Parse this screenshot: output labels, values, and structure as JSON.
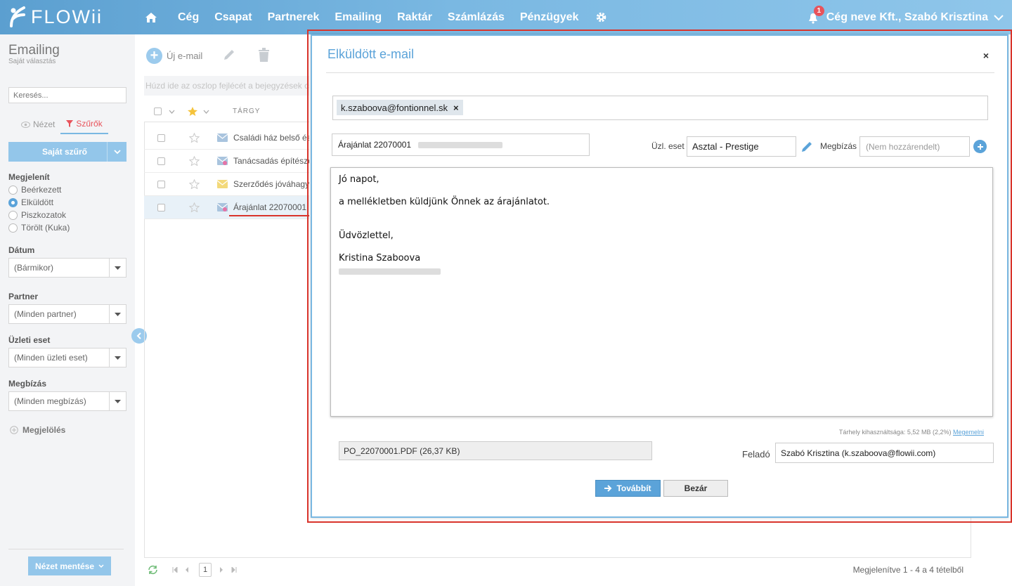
{
  "app": {
    "logo_text": "FLOWii",
    "nav": [
      "Cég",
      "Csapat",
      "Partnerek",
      "Emailing",
      "Raktár",
      "Számlázás",
      "Pénzügyek"
    ],
    "notification_count": "1",
    "user": "Cég neve Kft., Szabó Krisztina",
    "accent_color": "#5ba3d9",
    "highlight_color": "#d9342b"
  },
  "sidebar": {
    "title": "Emailing",
    "subtitle": "Saját választás",
    "search_placeholder": "Keresés...",
    "tab_view": "Nézet",
    "tab_filters": "Szűrők",
    "own_filter_button": "Saját szűrő",
    "show_label": "Megjelenít",
    "show_options": [
      "Beérkezett",
      "Elküldött",
      "Piszkozatok",
      "Törölt (Kuka)"
    ],
    "show_selected": "Elküldött",
    "date_label": "Dátum",
    "date_value": "(Bármikor)",
    "partner_label": "Partner",
    "partner_value": "(Minden partner)",
    "deal_label": "Üzleti eset",
    "deal_value": "(Minden üzleti eset)",
    "task_label": "Megbízás",
    "task_value": "(Minden megbízás)",
    "mark_label": "Megjelölés",
    "save_view_button": "Nézet mentése"
  },
  "list": {
    "new_email": "Új e-mail",
    "group_hint": "Húzd ide az oszlop fejlécét a bejegyzések csoportosításához",
    "subject_header": "TÁRGY",
    "rows": [
      {
        "subject": "Családi ház belső és külső",
        "icon": "envelope-icon",
        "selected": false
      },
      {
        "subject": "Tanácsadás építészeti",
        "icon": "envelope-heart-icon",
        "selected": false
      },
      {
        "subject": "Szerződés jóváhagyása",
        "icon": "envelope-yellow-icon",
        "selected": false
      },
      {
        "subject": "Árajánlat 22070001",
        "icon": "envelope-heart-icon",
        "selected": true
      }
    ],
    "page": "1",
    "pager_info": "Megjelenítve 1 - 4 a 4 tételből"
  },
  "modal": {
    "title": "Elküldött e-mail",
    "close": "×",
    "recipient": "k.szaboova@fontionnel.sk",
    "recipient_remove": "×",
    "subject": "Árajánlat 22070001",
    "deal_label": "Üzl. eset",
    "deal_value": "Asztal - Prestige",
    "task_label": "Megbízás",
    "task_placeholder": "(Nem hozzárendelt)",
    "body": {
      "greeting": "Jó napot,",
      "line1": "a mellékletben küldjünk Önnek az árajánlatot.",
      "closing": "Üdvözlettel,",
      "signature": "Kristina Szaboova"
    },
    "storage_text": "Tárhely kihasználtsága: 5,52 MB (2,2%)",
    "storage_link": "Megemelni",
    "attachment": "PO_22070001.PDF (26,37 KB)",
    "sender_label": "Feladó",
    "sender_value": "Szabó Krisztina (k.szaboova@flowii.com)",
    "forward_button": "Továbbít",
    "close_button": "Bezár"
  }
}
